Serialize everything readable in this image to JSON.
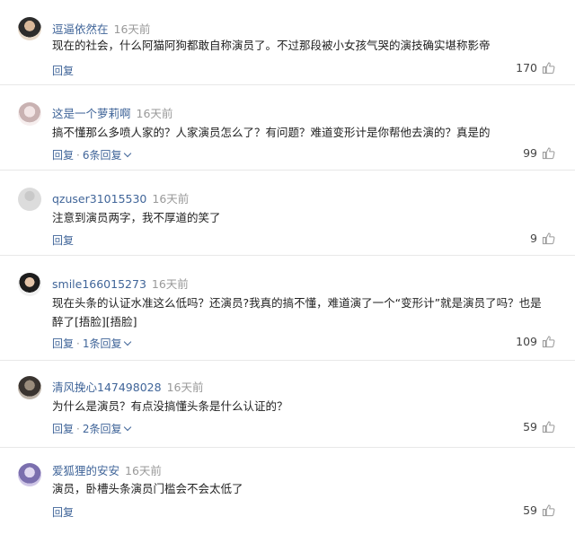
{
  "comments": [
    {
      "username": "逗逼依然在",
      "time": "16天前",
      "text": "现在的社会，什么阿猫阿狗都敢自称演员了。不过那段被小女孩气哭的演技确实堪称影帝",
      "reply_label": "回复",
      "replies": "",
      "likes": "170"
    },
    {
      "username": "这是一个萝莉啊",
      "time": "16天前",
      "text": "搞不懂那么多喷人家的？人家演员怎么了？有问题？难道变形计是你帮他去演的？真是的",
      "reply_label": "回复",
      "replies": "6条回复",
      "likes": "99"
    },
    {
      "username": "qzuser31015530",
      "time": "16天前",
      "text": "注意到演员两字，我不厚道的笑了",
      "reply_label": "回复",
      "replies": "",
      "likes": "9"
    },
    {
      "username": "smile166015273",
      "time": "16天前",
      "text": "现在头条的认证水准这么低吗？还演员?我真的搞不懂，难道演了一个“变形计”就是演员了吗？也是醉了[捂脸][捂脸]",
      "reply_label": "回复",
      "replies": "1条回复",
      "likes": "109"
    },
    {
      "username": "清风挽心147498028",
      "time": "16天前",
      "text": "为什么是演员？有点没搞懂头条是什么认证的？",
      "reply_label": "回复",
      "replies": "2条回复",
      "likes": "59"
    },
    {
      "username": "爱狐狸的安安",
      "time": "16天前",
      "text": "演员，卧槽头条演员门槛会不会太低了",
      "reply_label": "回复",
      "replies": "",
      "likes": "59"
    }
  ],
  "icons": {
    "like": "thumbs-up-icon",
    "expand": "chevron-down-icon"
  },
  "colors": {
    "username": "#406599",
    "time": "#999999",
    "text": "#222222",
    "divider": "#e8e8e8"
  }
}
